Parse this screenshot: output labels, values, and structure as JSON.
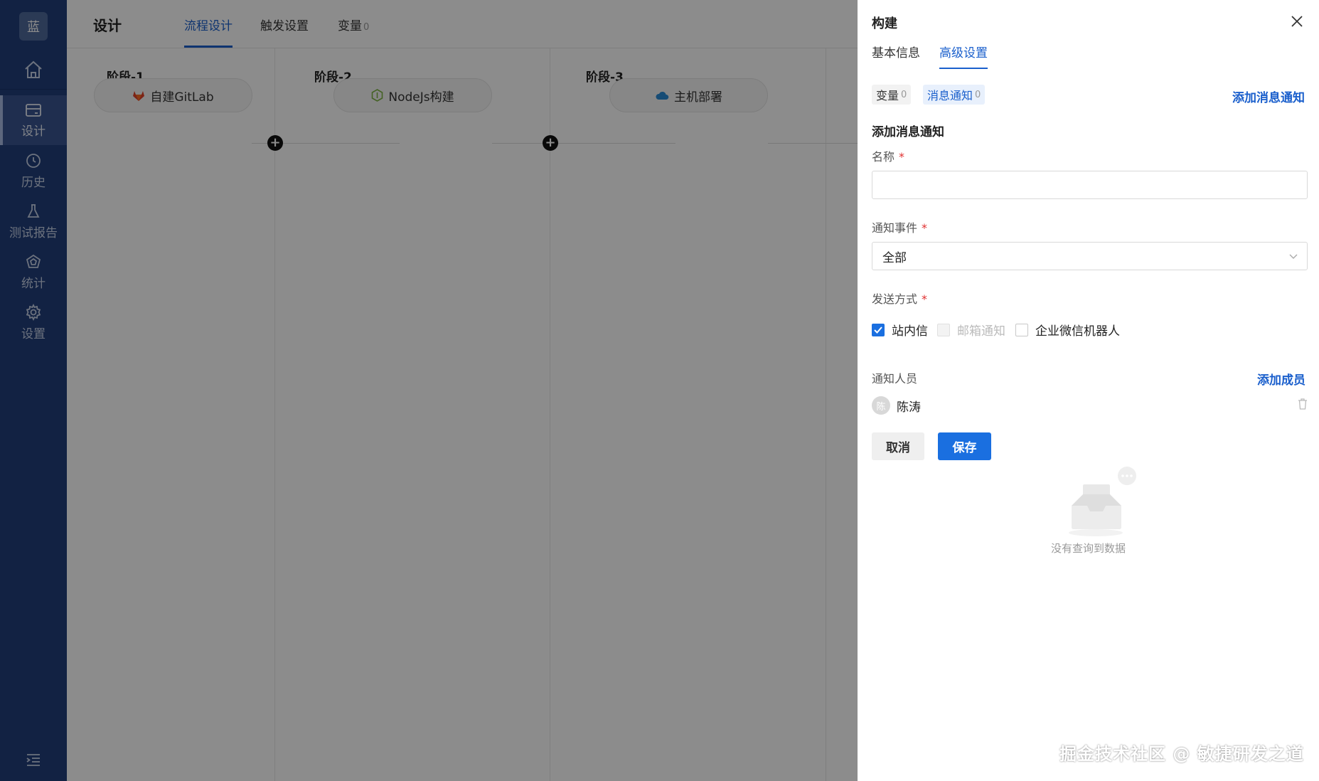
{
  "sidebar": {
    "logo_text": "蓝",
    "items": [
      {
        "label": "设计",
        "icon": "layout-icon"
      },
      {
        "label": "历史",
        "icon": "clock-icon"
      },
      {
        "label": "测试报告",
        "icon": "flask-icon"
      },
      {
        "label": "统计",
        "icon": "chart-icon"
      },
      {
        "label": "设置",
        "icon": "gear-icon"
      }
    ],
    "active_item": "设计"
  },
  "header": {
    "title": "设计",
    "tabs": [
      {
        "label": "流程设计",
        "active": true
      },
      {
        "label": "触发设置",
        "active": false
      },
      {
        "label": "变量",
        "count": "0",
        "active": false
      }
    ]
  },
  "pipeline": {
    "stages": [
      {
        "title": "阶段-1",
        "task": "自建GitLab",
        "icon": "gitlab-icon"
      },
      {
        "title": "阶段-2",
        "task": "NodeJs构建",
        "icon": "nodejs-icon"
      },
      {
        "title": "阶段-3",
        "task": "主机部署",
        "icon": "cloud-icon"
      }
    ],
    "add_symbol": "+"
  },
  "drawer": {
    "title": "构建",
    "tabs": [
      {
        "label": "基本信息",
        "active": false
      },
      {
        "label": "高级设置",
        "active": true
      }
    ],
    "chips": [
      {
        "label": "变量",
        "count": "0",
        "active": false
      },
      {
        "label": "消息通知",
        "count": "0",
        "active": true
      }
    ],
    "add_notification_link": "添加消息通知",
    "form": {
      "section_title": "添加消息通知",
      "name_label": "名称",
      "name_value": "",
      "event_label": "通知事件",
      "event_value": "全部",
      "method_label": "发送方式",
      "methods": [
        {
          "label": "站内信",
          "checked": true,
          "disabled": false
        },
        {
          "label": "邮箱通知",
          "checked": false,
          "disabled": true
        },
        {
          "label": "企业微信机器人",
          "checked": false,
          "disabled": false
        }
      ],
      "members_label": "通知人员",
      "add_member_link": "添加成员",
      "members": [
        {
          "avatar_text": "陈",
          "name": "陈涛"
        }
      ],
      "required_mark": "*",
      "cancel_label": "取消",
      "save_label": "保存"
    },
    "empty_state_text": "没有查询到数据"
  },
  "watermark": "掘金技术社区 @ 敏捷研发之道",
  "colors": {
    "sidebar_bg": "#223f7a",
    "accent": "#1a5fcc",
    "primary_button": "#1a6fe0",
    "required": "#e03030"
  }
}
